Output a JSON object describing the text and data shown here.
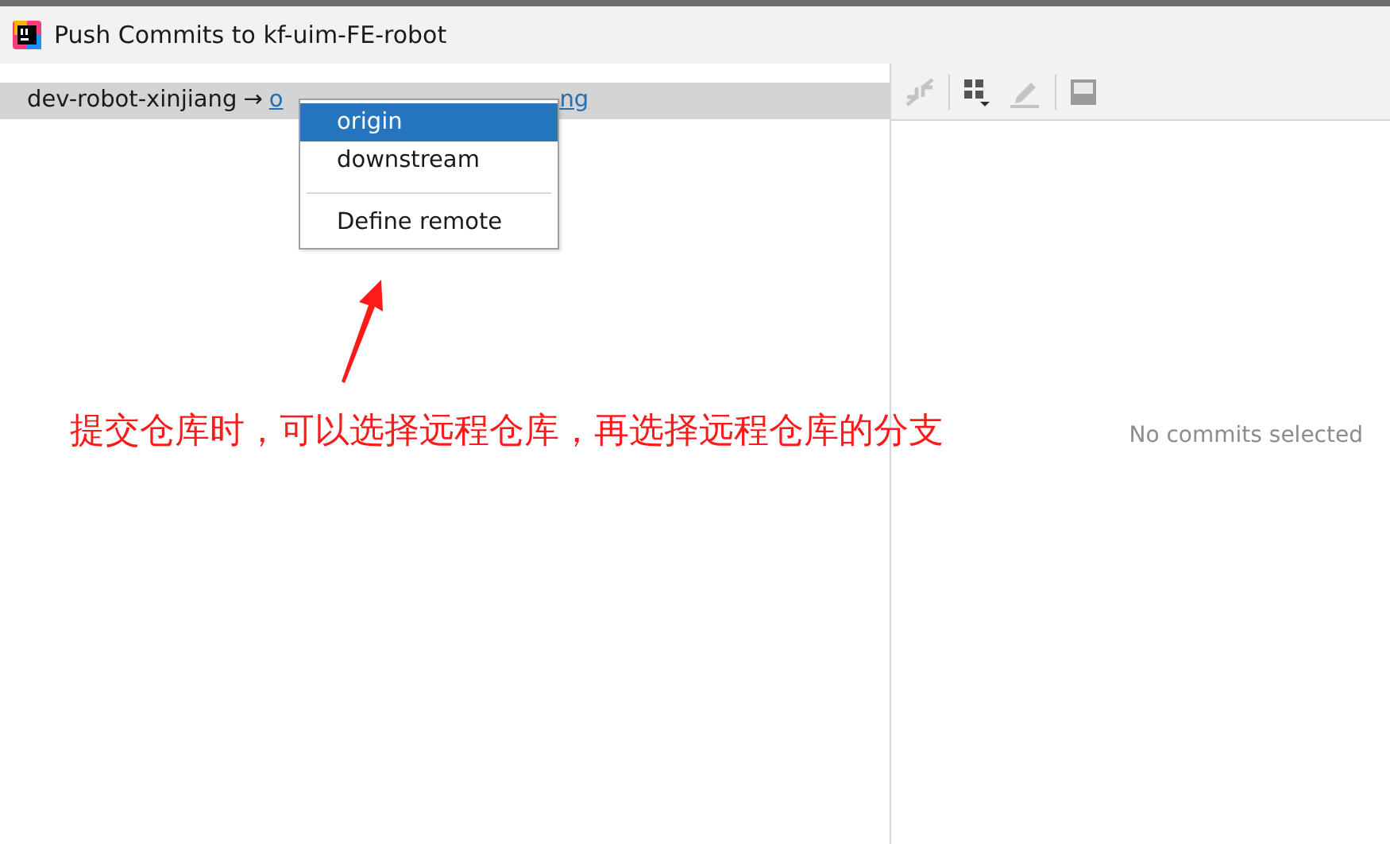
{
  "window": {
    "title": "Push Commits to kf-uim-FE-robot"
  },
  "branch_row": {
    "local_branch": "dev-robot-xinjiang",
    "arrow": "→",
    "target_visible_start": "o",
    "target_visible_end": "ng"
  },
  "remote_menu": {
    "items": [
      {
        "label": "origin",
        "selected": true
      },
      {
        "label": "downstream",
        "selected": false
      },
      {
        "label": "Define remote",
        "selected": false,
        "separator_before": true
      }
    ]
  },
  "annotation": {
    "text": "提交仓库时，可以选择远程仓库，再选择远程仓库的分支"
  },
  "details_panel": {
    "empty_text": "No commits selected"
  }
}
